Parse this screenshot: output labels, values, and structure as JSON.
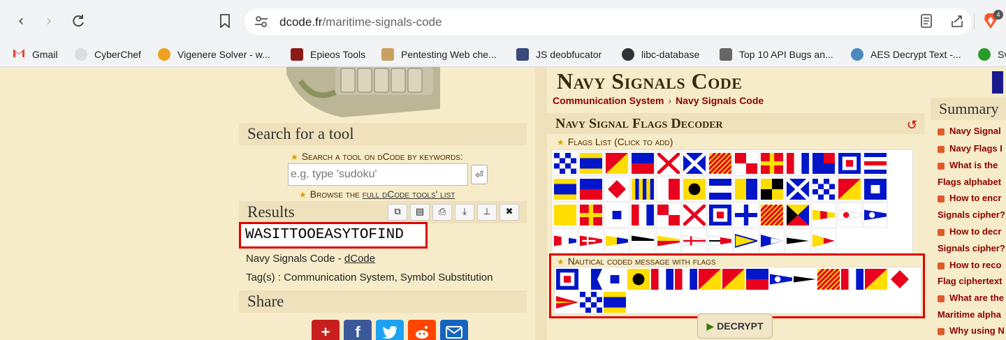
{
  "browser": {
    "url_domain": "dcode.fr",
    "url_path": "/maritime-signals-code",
    "bookmarks": [
      {
        "label": "Gmail",
        "color": "#ea4335"
      },
      {
        "label": "CyberChef",
        "color": "#cccccc"
      },
      {
        "label": "Vigenere Solver - w...",
        "color": "#f0a020"
      },
      {
        "label": "Epieos Tools",
        "color": "#8b1a1a"
      },
      {
        "label": "Pentesting Web che...",
        "color": "#444444"
      },
      {
        "label": "JS deobfucator",
        "color": "#3a4a7a"
      },
      {
        "label": "libc-database",
        "color": "#222222"
      },
      {
        "label": "Top 10 API Bugs an...",
        "color": "#333333"
      },
      {
        "label": "AES Decrypt Text -...",
        "color": "#4a8ac0"
      },
      {
        "label": "Sv",
        "color": "#2a9a2a"
      }
    ],
    "brave_badge": "4"
  },
  "left": {
    "search_heading": "Search for a tool",
    "search_label": "Search a tool on dCode by keywords:",
    "search_placeholder": "e.g. type 'sudoku'",
    "search_go": "⏎",
    "browse_prefix": "Browse the ",
    "browse_link": "full dCode tools' list",
    "results_heading": "Results",
    "result_value": "WASITTOOEASYTOFIND",
    "result_name": "Navy Signals Code - ",
    "result_link": "dCode",
    "tags": "Tag(s) : Communication System, Symbol Substitution",
    "share_heading": "Share"
  },
  "main": {
    "title": "Navy Signals Code",
    "crumb1": "Communication System",
    "crumb_sep": "›",
    "crumb2": "Navy Signals Code",
    "decoder_heading": "Navy Signal Flags Decoder",
    "refresh": "↺",
    "flags_list_label": "Flags List (Click to add)",
    "message_label": "Nautical coded message with flags",
    "decrypt_label": "DECRYPT"
  },
  "summary": {
    "heading": "Summary",
    "items": [
      "Navy Signal",
      "Navy Flags I",
      "What is the",
      "Flags alphabet",
      "How to encr",
      "Signals cipher?",
      "How to decr",
      "Signals cipher?",
      "How to reco",
      "Flag ciphertext",
      "What are the",
      "Maritime alpha",
      "Why using N"
    ]
  },
  "colors": {
    "red": "#e8001c",
    "yellow": "#ffdd00",
    "blue": "#0016c8",
    "black": "#000000",
    "white": "#ffffff"
  }
}
